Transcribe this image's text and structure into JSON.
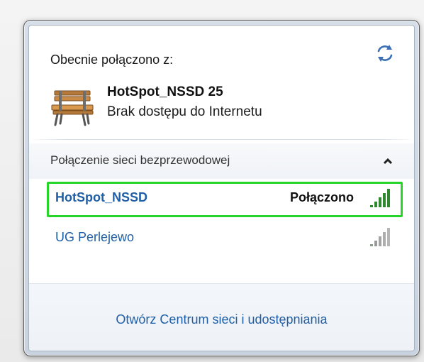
{
  "header": {
    "current_label": "Obecnie połączono z:",
    "refresh_icon": "refresh-icon"
  },
  "connected": {
    "icon": "bench-icon",
    "name": "HotSpot_NSSD  25",
    "status": "Brak dostępu do Internetu"
  },
  "section": {
    "title": "Połączenie sieci bezprzewodowej",
    "collapse_icon": "chevron-up-icon"
  },
  "networks": [
    {
      "name": "HotSpot_NSSD",
      "state": "Połączono",
      "signal_bars": 5,
      "highlight_color": "#27d52a"
    },
    {
      "name": "UG Perlejewo",
      "state": "",
      "signal_bars": 5
    }
  ],
  "footer": {
    "link": "Otwórz Centrum sieci i udostępniania"
  },
  "colors": {
    "link_blue": "#1f5fa6",
    "signal_green": "#2f8a2f",
    "signal_gray": "#9a9a9a"
  }
}
